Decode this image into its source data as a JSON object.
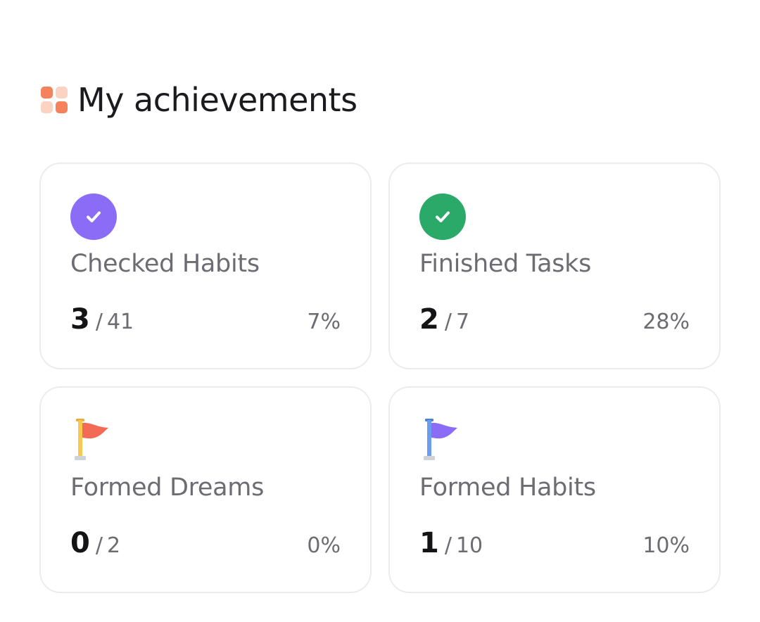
{
  "header": {
    "title": "My achievements",
    "icon": "achievements-grid-icon",
    "icon_colors": [
      "#f4825b",
      "#fad3c3",
      "#fad3c3",
      "#f4825b"
    ]
  },
  "cards": [
    {
      "label": "Checked Habits",
      "count": "3",
      "separator": "/",
      "total": "41",
      "percent": "7%",
      "icon": "check-circle-icon",
      "icon_color": "#8a6cf6"
    },
    {
      "label": "Finished Tasks",
      "count": "2",
      "separator": "/",
      "total": "7",
      "percent": "28%",
      "icon": "check-circle-icon",
      "icon_color": "#2aa968"
    },
    {
      "label": "Formed Dreams",
      "count": "0",
      "separator": "/",
      "total": "2",
      "percent": "0%",
      "icon": "flag-icon",
      "icon_color": "#f36a55"
    },
    {
      "label": "Formed Habits",
      "count": "1",
      "separator": "/",
      "total": "10",
      "percent": "10%",
      "icon": "flag-icon",
      "icon_color": "#8a6cf6"
    }
  ]
}
